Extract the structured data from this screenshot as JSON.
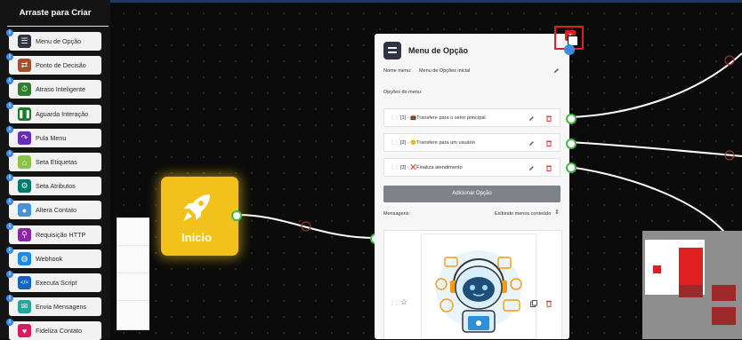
{
  "sidebar": {
    "title": "Arraste para Criar",
    "items": [
      {
        "label": "Menu de Opção",
        "icon": "menu-lines-icon",
        "color": "#2f3542"
      },
      {
        "label": "Ponto de Decisão",
        "icon": "signpost-icon",
        "color": "#a0522d"
      },
      {
        "label": "Atraso Inteligente",
        "icon": "timer-icon",
        "color": "#2e7d32"
      },
      {
        "label": "Aguarda Interação",
        "icon": "pause-icon",
        "color": "#1b7d2a"
      },
      {
        "label": "Pula Menu",
        "icon": "jump-icon",
        "color": "#6a2bb5"
      },
      {
        "label": "Seta Etiquetas",
        "icon": "tags-icon",
        "color": "#8bc34a"
      },
      {
        "label": "Seta Atributos",
        "icon": "attributes-icon",
        "color": "#00796b"
      },
      {
        "label": "Altera Contato",
        "icon": "contact-icon",
        "color": "#4a90d9"
      },
      {
        "label": "Requisição HTTP",
        "icon": "webhook-share-icon",
        "color": "#8e24aa"
      },
      {
        "label": "Webhook",
        "icon": "globe-icon",
        "color": "#1e88e5"
      },
      {
        "label": "Executa Script",
        "icon": "code-icon",
        "color": "#1565c0"
      },
      {
        "label": "Envia Mensagens",
        "icon": "chat-icon",
        "color": "#26a69a"
      },
      {
        "label": "Fideliza Contato",
        "icon": "loyalty-icon",
        "color": "#d81b60"
      }
    ]
  },
  "start_node": {
    "label": "Inicio",
    "icon": "rocket-icon",
    "color": "#f3c11b"
  },
  "menu_card": {
    "title": "Menu de Opção",
    "name_label": "Nome menu:",
    "name_value": "Menu de Opções inicial",
    "options_label": "Opções do menu:",
    "options": [
      {
        "text": "[1] - 💼Transfere para o setor principal"
      },
      {
        "text": "[2] - 😊Transfere para um usuário"
      },
      {
        "text": "[3] - ❌Finaliza atendimento"
      }
    ],
    "add_option_label": "Adicionar Opção",
    "messages_label": "Mensagens:",
    "show_less_label": "Exibindo menos conteúdo"
  },
  "colors": {
    "accent_green": "#44b84a",
    "canvas_bg": "#0b0b0b",
    "highlight_red": "#e02020"
  }
}
